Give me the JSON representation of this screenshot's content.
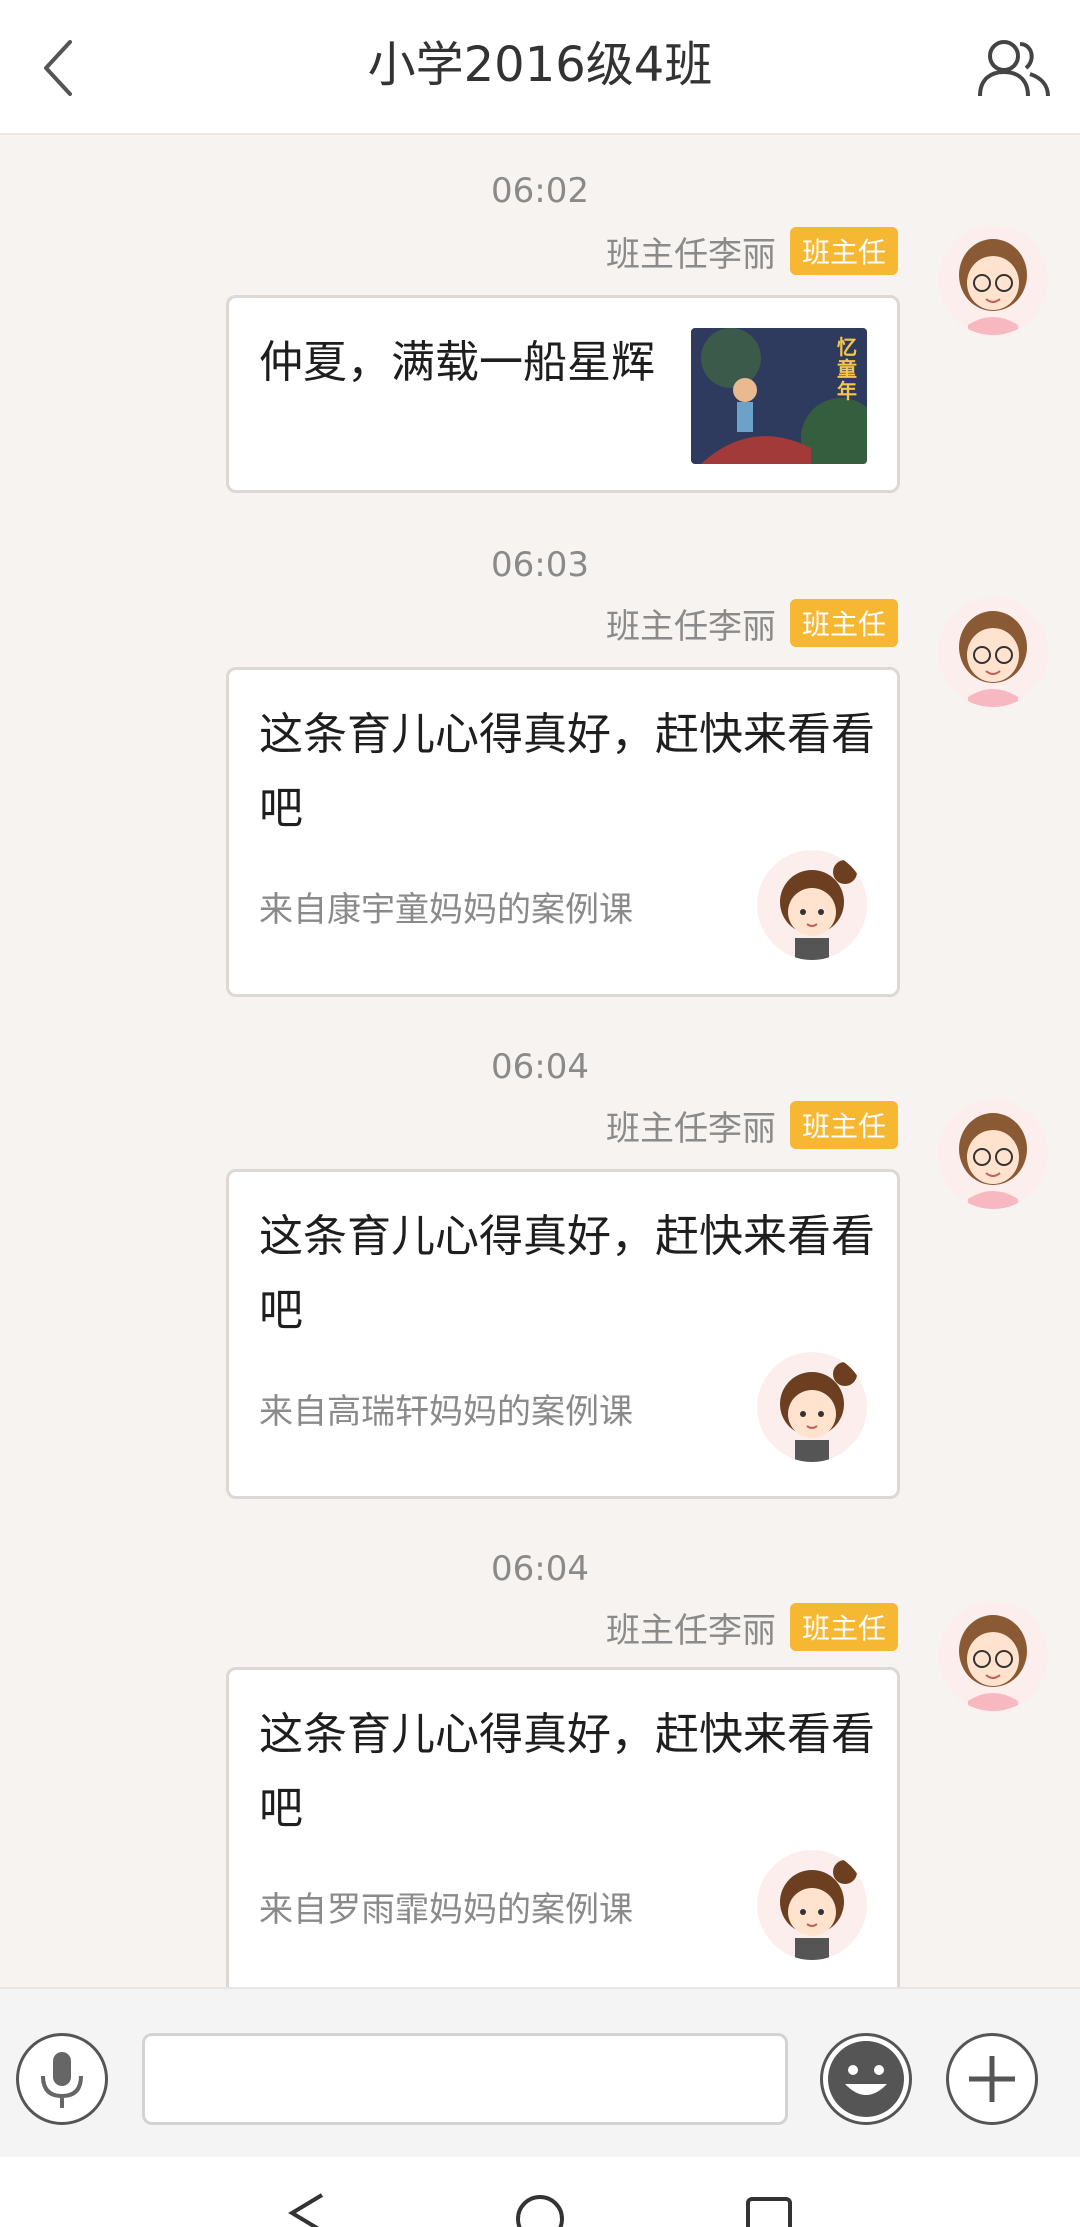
{
  "header": {
    "title": "小学2016级4班",
    "back_icon": "chevron-left-icon",
    "members_icon": "group-icon"
  },
  "messages": [
    {
      "time": "06:02",
      "sender": "班主任李丽",
      "badge": "班主任",
      "text": "仲夏，满载一船星辉",
      "thumbnail_caption": "忆童年"
    },
    {
      "time": "06:03",
      "sender": "班主任李丽",
      "badge": "班主任",
      "text": "这条育儿心得真好，赶快来看看吧",
      "source": "来自康宇童妈妈的案例课"
    },
    {
      "time": "06:04",
      "sender": "班主任李丽",
      "badge": "班主任",
      "text": "这条育儿心得真好，赶快来看看吧",
      "source": "来自高瑞轩妈妈的案例课"
    },
    {
      "time": "06:04",
      "sender": "班主任李丽",
      "badge": "班主任",
      "text": "这条育儿心得真好，赶快来看看吧",
      "source": "来自罗雨霏妈妈的案例课"
    }
  ],
  "input_bar": {
    "voice_icon": "microphone-icon",
    "input_value": "",
    "emoji_icon": "smiley-icon",
    "plus_icon": "plus-icon"
  },
  "colors": {
    "badge": "#f6b733",
    "background": "#f7f3f0"
  }
}
